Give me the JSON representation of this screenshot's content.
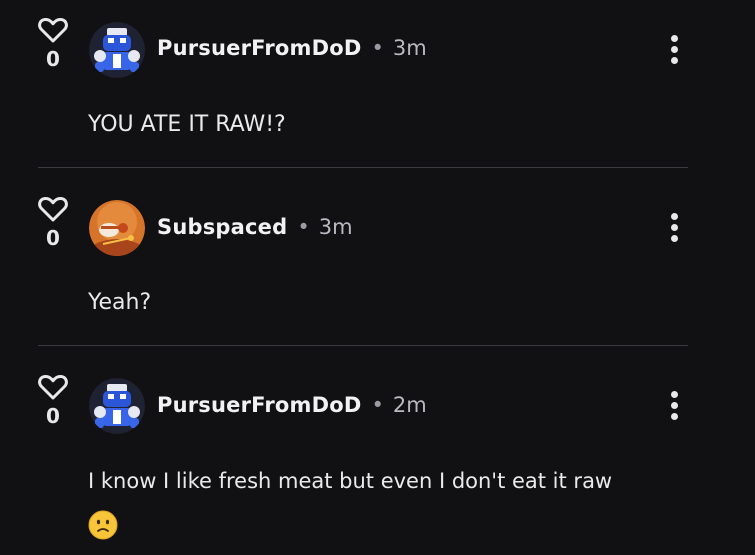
{
  "comments": [
    {
      "username": "PursuerFromDoD",
      "separator": "•",
      "time": "3m",
      "vote_count": "0",
      "text": "YOU ATE IT RAW!?",
      "avatar_icon": "robot-avatar-icon"
    },
    {
      "username": "Subspaced",
      "separator": "•",
      "time": "3m",
      "vote_count": "0",
      "text": "Yeah?",
      "avatar_icon": "orange-character-avatar-icon"
    },
    {
      "username": "PursuerFromDoD",
      "separator": "•",
      "time": "2m",
      "vote_count": "0",
      "text": "I know I like fresh meat but even I don't eat it raw",
      "emoji": "worried-face-emoji",
      "avatar_icon": "robot-avatar-icon"
    }
  ],
  "colors": {
    "background": "#111114",
    "text": "#eaeaec",
    "muted": "#b9b9c0",
    "divider": "#3a3a40"
  }
}
